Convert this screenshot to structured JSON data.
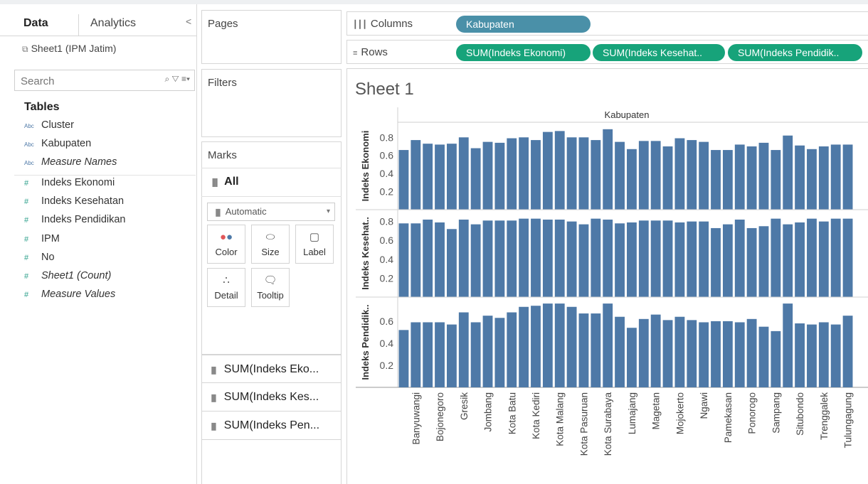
{
  "colors": {
    "bar": "#4e79a7",
    "dimension_pill": "#4a90a8",
    "measure_pill": "#17a37a"
  },
  "data_pane": {
    "tabs": [
      "Data",
      "Analytics"
    ],
    "collapse_glyph": "<",
    "data_source": "Sheet1 (IPM Jatim)",
    "search_placeholder": "Search",
    "tables_heading": "Tables",
    "dimensions": [
      "Cluster",
      "Kabupaten",
      "Measure Names"
    ],
    "measures": [
      "Indeks Ekonomi",
      "Indeks Kesehatan",
      "Indeks Pendidikan",
      "IPM",
      "No",
      "Sheet1 (Count)",
      "Measure Values"
    ],
    "type_abc": "Abc",
    "type_num": "#"
  },
  "pages_title": "Pages",
  "filters_title": "Filters",
  "marks": {
    "title": "Marks",
    "all_label": "All",
    "type_select": "Automatic",
    "buttons": [
      "Color",
      "Size",
      "Label",
      "Detail",
      "Tooltip"
    ],
    "fields": [
      "SUM(Indeks Eko...",
      "SUM(Indeks Kes...",
      "SUM(Indeks Pen..."
    ]
  },
  "shelves": {
    "columns_label": "Columns",
    "rows_label": "Rows",
    "columns_pill": "Kabupaten",
    "rows_pills": [
      "SUM(Indeks Ekonomi)",
      "SUM(Indeks Kesehat..",
      "SUM(Indeks Pendidik.."
    ]
  },
  "sheet_title": "Sheet 1",
  "chart_data": {
    "type": "bar",
    "title": "Kabupaten",
    "x_labels_shown": [
      "Banyuwangi",
      "Bojonegoro",
      "Gresik",
      "Jombang",
      "Kota Batu",
      "Kota Kediri",
      "Kota Malang",
      "Kota Pasuruan",
      "Kota Surabaya",
      "Lumajang",
      "Magetan",
      "Mojokerto",
      "Ngawi",
      "Pamekasan",
      "Ponorogo",
      "Sampang",
      "Situbondo",
      "Trenggalek",
      "Tulungagung"
    ],
    "series": [
      {
        "name": "Indeks Ekonomi",
        "axis_label": "Indeks Ekonomi",
        "ticks": [
          0.2,
          0.4,
          0.6,
          0.8
        ],
        "ylim": [
          0,
          0.92
        ],
        "values": [
          0.66,
          0.77,
          0.73,
          0.72,
          0.73,
          0.8,
          0.68,
          0.75,
          0.74,
          0.79,
          0.8,
          0.77,
          0.86,
          0.87,
          0.8,
          0.8,
          0.77,
          0.89,
          0.75,
          0.67,
          0.76,
          0.76,
          0.7,
          0.79,
          0.77,
          0.75,
          0.66,
          0.66,
          0.72,
          0.7,
          0.74,
          0.66,
          0.82,
          0.71,
          0.67,
          0.7,
          0.72,
          0.72
        ]
      },
      {
        "name": "Indeks Kesehatan",
        "axis_label": "Indeks Kesehat..",
        "ticks": [
          0.2,
          0.4,
          0.6,
          0.8
        ],
        "ylim": [
          0,
          0.88
        ],
        "values": [
          0.78,
          0.78,
          0.82,
          0.79,
          0.72,
          0.82,
          0.77,
          0.81,
          0.81,
          0.81,
          0.83,
          0.83,
          0.82,
          0.82,
          0.8,
          0.77,
          0.83,
          0.82,
          0.78,
          0.79,
          0.81,
          0.81,
          0.81,
          0.79,
          0.8,
          0.8,
          0.73,
          0.77,
          0.82,
          0.73,
          0.75,
          0.83,
          0.77,
          0.79,
          0.83,
          0.8,
          0.83,
          0.83
        ]
      },
      {
        "name": "Indeks Pendidikan",
        "axis_label": "Indeks Pendidik..",
        "ticks": [
          0.2,
          0.4,
          0.6
        ],
        "ylim": [
          0,
          0.78
        ],
        "values": [
          0.52,
          0.59,
          0.59,
          0.59,
          0.57,
          0.68,
          0.59,
          0.65,
          0.63,
          0.68,
          0.73,
          0.74,
          0.76,
          0.76,
          0.73,
          0.67,
          0.67,
          0.76,
          0.64,
          0.54,
          0.62,
          0.66,
          0.61,
          0.64,
          0.61,
          0.59,
          0.6,
          0.6,
          0.59,
          0.62,
          0.55,
          0.51,
          0.76,
          0.58,
          0.57,
          0.59,
          0.57,
          0.65
        ]
      }
    ]
  }
}
